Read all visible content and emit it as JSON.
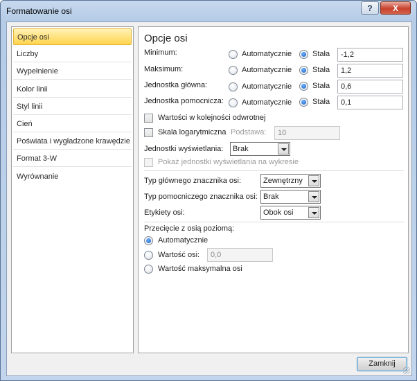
{
  "window": {
    "title": "Formatowanie osi",
    "help_label": "?",
    "close_label": "X"
  },
  "nav": {
    "items": [
      {
        "label": "Opcje osi",
        "selected": true
      },
      {
        "label": "Liczby"
      },
      {
        "label": "Wypełnienie"
      },
      {
        "label": "Kolor linii"
      },
      {
        "label": "Styl linii"
      },
      {
        "label": "Cień"
      },
      {
        "label": "Poświata i wygładzone krawędzie"
      },
      {
        "label": "Format 3-W"
      },
      {
        "label": "Wyrównanie"
      }
    ]
  },
  "panel": {
    "heading": "Opcje osi",
    "rows": [
      {
        "label": "Minimum:",
        "auto_label": "Automatycznie",
        "fixed_label": "Stała",
        "value": "-1,2"
      },
      {
        "label": "Maksimum:",
        "auto_label": "Automatycznie",
        "fixed_label": "Stała",
        "value": "1,2"
      },
      {
        "label": "Jednostka główna:",
        "auto_label": "Automatycznie",
        "fixed_label": "Stała",
        "value": "0,6"
      },
      {
        "label": "Jednostka pomocnicza:",
        "auto_label": "Automatycznie",
        "fixed_label": "Stała",
        "value": "0,1"
      }
    ],
    "reverse_order_label": "Wartości w kolejności odwrotnej",
    "log_scale_label": "Skala logarytmiczna",
    "base_label": "Podstawa:",
    "base_value": "10",
    "display_units_label": "Jednostki wyświetlania:",
    "display_units_value": "Brak",
    "show_units_label": "Pokaż jednostki wyświetlania na wykresie",
    "major_tick_label": "Typ głównego znacznika osi:",
    "major_tick_value": "Zewnętrzny",
    "minor_tick_label": "Typ pomocniczego znacznika osi:",
    "minor_tick_value": "Brak",
    "axis_labels_label": "Etykiety osi:",
    "axis_labels_value": "Obok osi",
    "crosses_heading": "Przecięcie z osią poziomą:",
    "crosses_auto_label": "Automatycznie",
    "crosses_value_label": "Wartość osi:",
    "crosses_value": "0,0",
    "crosses_max_label": "Wartość maksymalna osi"
  },
  "footer": {
    "close_button": "Zamknij"
  }
}
